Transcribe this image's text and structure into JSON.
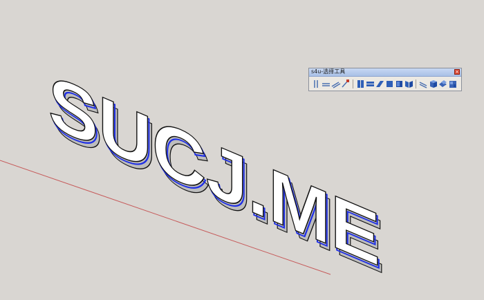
{
  "scene": {
    "text_3d": "SUCJ.ME",
    "colors": {
      "background": "#d9d6d2",
      "face": "#ffffff",
      "side": "#bdbdbd",
      "outline": "#111111",
      "selected_edge": "#1f2fe6",
      "axis_red": "#c65b5b"
    }
  },
  "toolbar": {
    "title": "s4u-选择工具",
    "close_icon": "close-icon",
    "tools": [
      {
        "name": "vertical-lines-icon",
        "color": "#4a6fb0"
      },
      {
        "name": "horizontal-lines-icon",
        "color": "#4a6fb0"
      },
      {
        "name": "diagonal-lines-icon",
        "color": "#4a6fb0"
      },
      {
        "name": "pen-select-icon",
        "color": "#c23b2c"
      },
      {
        "name": "vertical-faces-icon",
        "color": "#2f5fb7"
      },
      {
        "name": "horizontal-faces-icon",
        "color": "#2f5fb7"
      },
      {
        "name": "slanted-faces-icon",
        "color": "#2f5fb7"
      },
      {
        "name": "face-select-icon",
        "color": "#2f5fb7"
      },
      {
        "name": "box-faces-icon",
        "color": "#2f5fb7"
      },
      {
        "name": "book-faces-icon",
        "color": "#2f5fb7"
      },
      {
        "name": "parallel-edges-icon",
        "color": "#4a6fb0"
      },
      {
        "name": "cube-icon",
        "color": "#3a63b5"
      },
      {
        "name": "cube-stack-icon",
        "color": "#3a63b5"
      },
      {
        "name": "grid-cube-icon",
        "color": "#3a63b5"
      }
    ]
  }
}
